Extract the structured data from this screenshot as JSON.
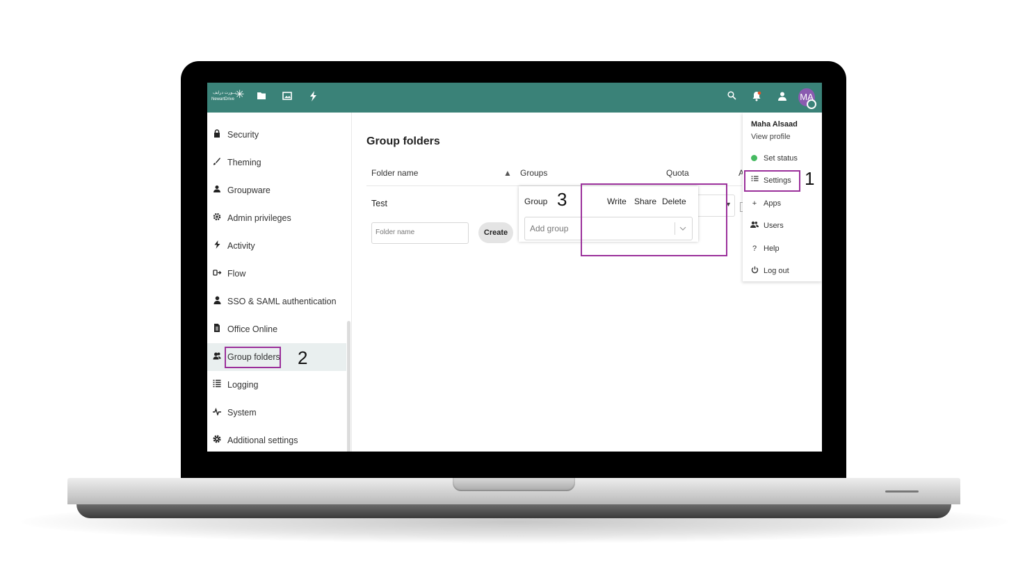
{
  "app": {
    "brand_ar": "نــورت درايف",
    "brand_en": "NewartDrive",
    "avatar_initials": "MA",
    "accent_color": "#3a8278",
    "highlight_color": "#9a2e9a"
  },
  "topbar": {
    "icons": [
      "files-icon",
      "photos-icon",
      "activity-icon",
      "search-icon",
      "notifications-icon",
      "contacts-icon"
    ]
  },
  "sidebar": {
    "items": [
      {
        "label": "Security",
        "icon": "lock-icon"
      },
      {
        "label": "Theming",
        "icon": "brush-icon"
      },
      {
        "label": "Groupware",
        "icon": "groupware-icon"
      },
      {
        "label": "Admin privileges",
        "icon": "admin-gear-icon"
      },
      {
        "label": "Activity",
        "icon": "lightning-icon"
      },
      {
        "label": "Flow",
        "icon": "flow-icon"
      },
      {
        "label": "SSO & SAML authentication",
        "icon": "user-icon"
      },
      {
        "label": "Office Online",
        "icon": "document-icon"
      },
      {
        "label": "Group folders",
        "icon": "group-icon",
        "active": true
      },
      {
        "label": "Logging",
        "icon": "list-icon"
      },
      {
        "label": "System",
        "icon": "pulse-icon"
      },
      {
        "label": "Additional settings",
        "icon": "gear-icon"
      }
    ]
  },
  "main": {
    "title": "Group folders",
    "columns": {
      "folder_name": "Folder name",
      "sort": "▲",
      "groups": "Groups",
      "quota": "Quota",
      "advanced": "A"
    },
    "rows": [
      {
        "folder_name": "Test"
      }
    ],
    "new_folder_placeholder": "Folder name",
    "create_label": "Create"
  },
  "group_popup": {
    "headers": {
      "group": "Group",
      "write": "Write",
      "share": "Share",
      "delete": "Delete"
    },
    "add_group_placeholder": "Add group"
  },
  "user_menu": {
    "name": "Maha Alsaad",
    "view_profile": "View profile",
    "items": [
      {
        "label": "Set status",
        "icon": "status-dot-icon"
      },
      {
        "label": "Settings",
        "icon": "settings-list-icon"
      },
      {
        "label": "Apps",
        "icon": "plus-icon"
      },
      {
        "label": "Users",
        "icon": "users-icon"
      },
      {
        "label": "Help",
        "icon": "help-icon"
      },
      {
        "label": "Log out",
        "icon": "power-icon"
      }
    ]
  },
  "callouts": {
    "step1": "1",
    "step2": "2",
    "step3": "3"
  }
}
